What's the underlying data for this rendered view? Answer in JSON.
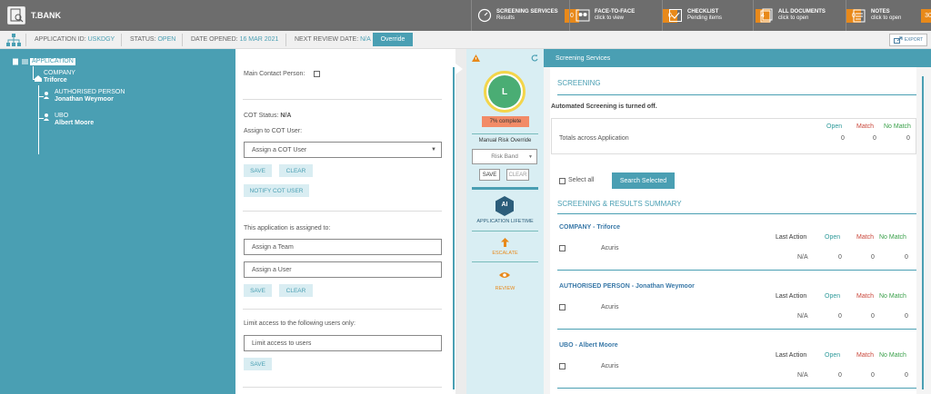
{
  "topbar": {
    "brand": "T.BANK",
    "items": [
      {
        "title": "SCREENING SERVICES",
        "sub": "Results",
        "count": "0",
        "icon": "gauge-icon"
      },
      {
        "title": "FACE-TO-FACE",
        "sub": "click to view",
        "count": "0",
        "icon": "faces-icon"
      },
      {
        "title": "CHECKLIST",
        "sub": "Pending items",
        "count": "4",
        "icon": "checklist-icon"
      },
      {
        "title": "ALL DOCUMENTS",
        "sub": "click to open",
        "count": "0",
        "icon": "documents-icon"
      },
      {
        "title": "NOTES",
        "sub": "click to open",
        "count": "30",
        "icon": "notes-icon"
      }
    ]
  },
  "infobar": {
    "app_id_label": "APPLICATION ID:",
    "app_id": "USKDGY",
    "status_label": "STATUS:",
    "status": "OPEN",
    "opened_label": "DATE OPENED:",
    "opened": "16 MAR 2021",
    "review_label": "NEXT REVIEW DATE:",
    "review": "N/A",
    "override": "Override",
    "export": "EXPORT"
  },
  "tree": {
    "root": "APPLICATION",
    "company_type": "COMPANY",
    "company_name": "Triforce",
    "person_type": "AUTHORISED PERSON",
    "person_name": "Jonathan Weymoor",
    "ubo_type": "UBO",
    "ubo_name": "Albert Moore"
  },
  "form": {
    "main_contact_label": "Main Contact Person:",
    "cot_status_label": "COT Status:",
    "cot_status": "N/A",
    "assign_cot_label": "Assign to COT User:",
    "assign_cot_placeholder": "Assign a COT User",
    "save": "SAVE",
    "clear": "CLEAR",
    "notify": "NOTIFY COT USER",
    "assigned_label": "This application is assigned to:",
    "assign_team": "Assign a Team",
    "assign_user": "Assign a User",
    "limit_label": "Limit access to the following users only:",
    "limit_placeholder": "Limit access to users"
  },
  "risk": {
    "band_letter": "L",
    "complete": "7% complete",
    "manual_override": "Manual Risk Override",
    "risk_band": "Risk Band",
    "save": "SAVE",
    "clear": "CLEAR",
    "ai_badge": "AI",
    "lifetime": "APPLICATION LIFETIME",
    "escalate": "ESCALATE",
    "review": "REVIEW",
    "colors": {
      "circle": "#4aad74",
      "ring": "#f3d54a",
      "pill": "#f28b67"
    }
  },
  "screening": {
    "header": "Screening Services",
    "section1": "SCREENING",
    "auto_off": "Automated Screening is turned off.",
    "totals_label": "Totals across Application",
    "col_open": "Open",
    "col_match": "Match",
    "col_nomatch": "No Match",
    "totals": {
      "open": "0",
      "match": "0",
      "nomatch": "0"
    },
    "select_all": "Select all",
    "search_selected": "Search Selected",
    "section2": "SCREENING & RESULTS SUMMARY",
    "last_action": "Last Action",
    "entities": [
      {
        "title": "COMPANY - Triforce",
        "provider": "Acuris",
        "last_action": "N/A",
        "open": "0",
        "match": "0",
        "nomatch": "0"
      },
      {
        "title": "AUTHORISED PERSON - Jonathan Weymoor",
        "provider": "Acuris",
        "last_action": "N/A",
        "open": "0",
        "match": "0",
        "nomatch": "0"
      },
      {
        "title": "UBO - Albert Moore",
        "provider": "Acuris",
        "last_action": "N/A",
        "open": "0",
        "match": "0",
        "nomatch": "0"
      }
    ],
    "colors": {
      "open": "#2e9a9a",
      "match": "#c9473b",
      "nomatch": "#3aa04a"
    }
  }
}
